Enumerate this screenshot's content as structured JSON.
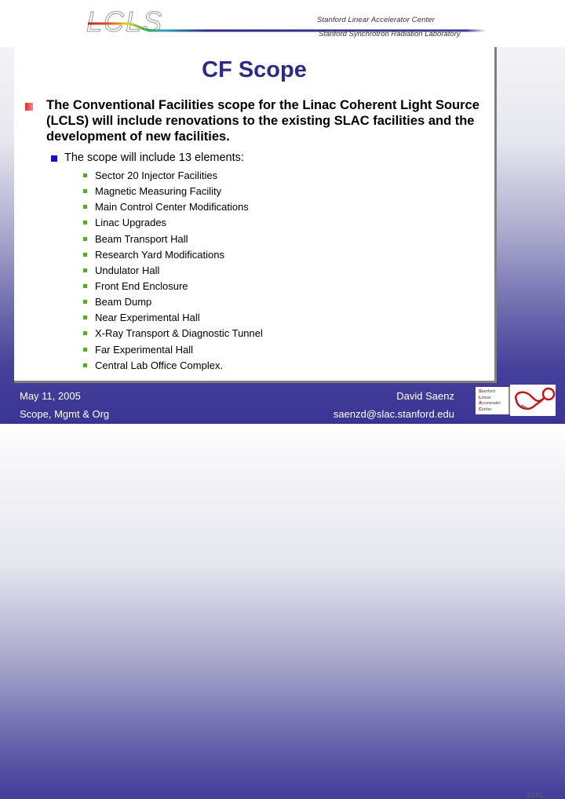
{
  "header": {
    "logo_text": "LCLS",
    "org_line1": "Stanford Linear Accelerator Center",
    "org_line2": "Stanford Synchrotron Radiation Laboratory"
  },
  "slide": {
    "title": "CF Scope",
    "main_bullet": "The Conventional Facilities scope for the Linac Coherent Light Source (LCLS) will include renovations to the existing SLAC facilities and the development of new facilities.",
    "sub_bullet": "The scope will include 13 elements:",
    "elements": [
      "Sector 20 Injector Facilities",
      "Magnetic Measuring Facility",
      "Main Control Center Modifications",
      "Linac Upgrades",
      "Beam Transport Hall",
      "Research Yard Modifications",
      "Undulator Hall",
      "Front End Enclosure",
      "Beam Dump",
      "Near Experimental Hall",
      "X-Ray Transport & Diagnostic Tunnel",
      "Far Experimental Hall",
      "Central Lab Office Complex."
    ]
  },
  "footer": {
    "date": "May 11, 2005",
    "section": "Scope, Mgmt & Org",
    "author": "David Saenz",
    "email": "saenzd@slac.stanford.edu",
    "slac_logo_lines": [
      "Stanford",
      "Linear",
      "Accelerator",
      "Center"
    ],
    "ssrl_logo_text": "SSRL"
  },
  "colors": {
    "title": "#2c2c86",
    "level1_bullet": "#e22c2c",
    "level2_bullet": "#1010c8",
    "level3_bullet": "#4fae2a",
    "footer_bg": "#3a3594"
  }
}
